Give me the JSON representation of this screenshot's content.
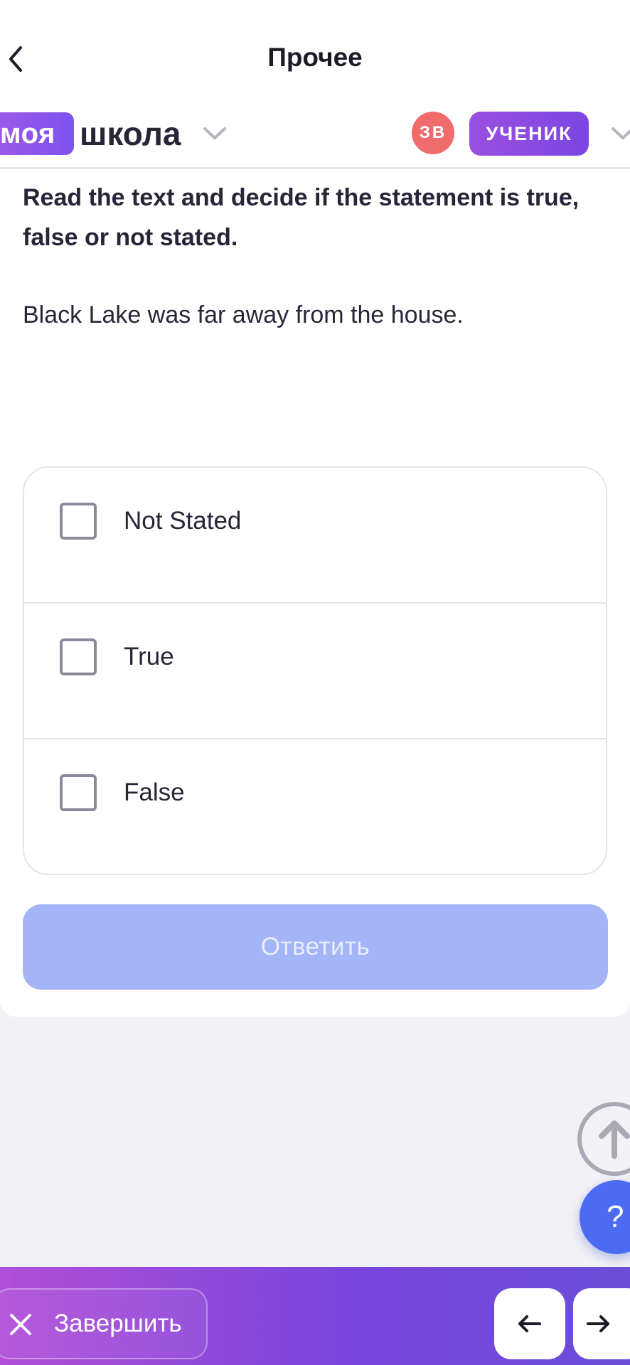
{
  "header": {
    "title": "Прочее",
    "back_icon": "chevron-left-icon"
  },
  "brand": {
    "logo_part1": "моя",
    "logo_part2": "школа",
    "avatar_initials": "ЗВ",
    "role": "УЧЕНИК"
  },
  "question": {
    "instruction": "Read the text and decide if the statement is true, false or not stated.",
    "statement": "Black Lake was far away from the house."
  },
  "options": [
    {
      "label": "Not Stated",
      "checked": false
    },
    {
      "label": "True",
      "checked": false
    },
    {
      "label": "False",
      "checked": false
    }
  ],
  "submit_label": "Ответить",
  "help_label": "?",
  "bottom_bar": {
    "finish_label": "Завершить"
  },
  "colors": {
    "accent": "#7c52f0",
    "submit_disabled": "#a3b4f7",
    "help": "#4b6cf2",
    "avatar": "#f06b6b"
  }
}
